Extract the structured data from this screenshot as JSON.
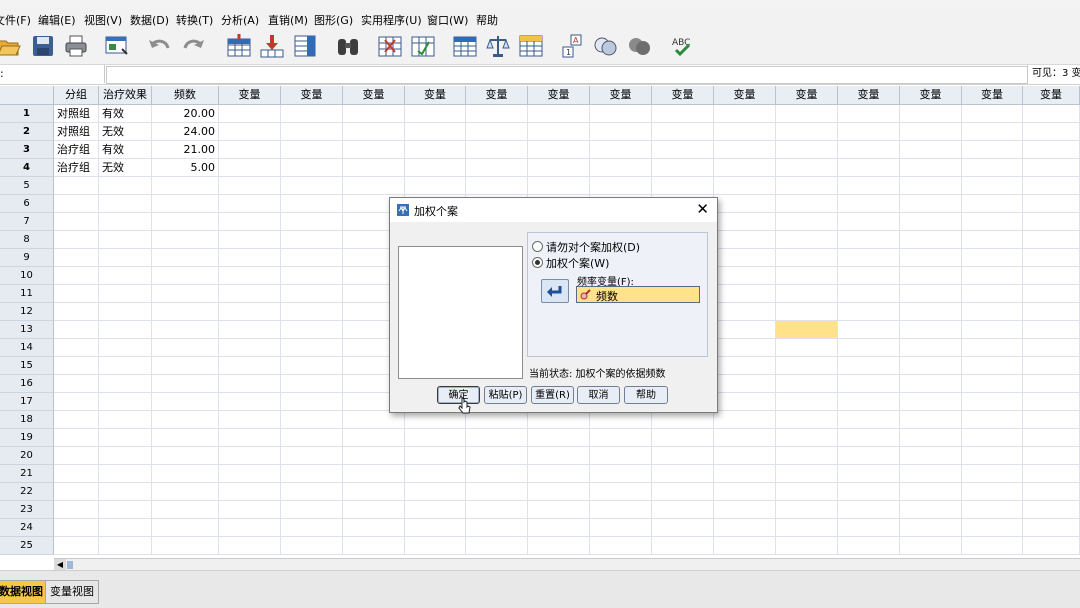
{
  "menu": [
    "文件(F)",
    "编辑(E)",
    "视图(V)",
    "数据(D)",
    "转换(T)",
    "分析(A)",
    "直销(M)",
    "图形(G)",
    "实用程序(U)",
    "窗口(W)",
    "帮助"
  ],
  "toolbar_icons": [
    "open-icon",
    "save-icon",
    "print-icon",
    "dialog-recall-icon",
    "undo-icon",
    "redo-icon",
    "goto-case-icon",
    "goto-variable-icon",
    "variables-icon",
    "find-icon",
    "insert-cases-icon",
    "insert-variable-icon",
    "split-file-icon",
    "weight-cases-icon",
    "select-cases-icon",
    "value-labels-icon",
    "use-sets-icon",
    "show-all-variables-icon",
    "spell-check-icon"
  ],
  "cellbar": {
    "ref": ":",
    "visible": "可见：3 变"
  },
  "grid": {
    "columns": [
      "分组",
      "治疗效果",
      "频数",
      "变量",
      "变量",
      "变量",
      "变量",
      "变量",
      "变量",
      "变量",
      "变量",
      "变量",
      "变量",
      "变量",
      "变量",
      "变量",
      "变量"
    ],
    "rows": [
      [
        "对照组",
        "有效",
        "20.00"
      ],
      [
        "对照组",
        "无效",
        "24.00"
      ],
      [
        "治疗组",
        "有效",
        "21.00"
      ],
      [
        "治疗组",
        "无效",
        "5.00"
      ]
    ],
    "row_numbers": [
      "1",
      "2",
      "3",
      "4",
      "5",
      "6",
      "7",
      "8",
      "9",
      "10",
      "11",
      "12",
      "13",
      "14",
      "15",
      "16",
      "17",
      "18",
      "19",
      "20",
      "21",
      "22",
      "23",
      "24",
      "25"
    ],
    "highlight_cell": {
      "row": 13,
      "col": 13
    },
    "highlight_color": "#ffe28a"
  },
  "tabs": {
    "data_view": "数据视图",
    "variable_view": "变量视图",
    "active_color": "#f6c84a"
  },
  "dialog": {
    "title": "加权个案",
    "close": "✕",
    "radio_none": "请勿对个案加权(D)",
    "radio_weight": "加权个案(W)",
    "freq_label": "频率变量(F):",
    "freq_value": "频数",
    "status": "当前状态: 加权个案的依据频数",
    "buttons": {
      "ok": "确定",
      "paste": "粘贴(P)",
      "reset": "重置(R)",
      "cancel": "取消",
      "help": "帮助"
    }
  }
}
